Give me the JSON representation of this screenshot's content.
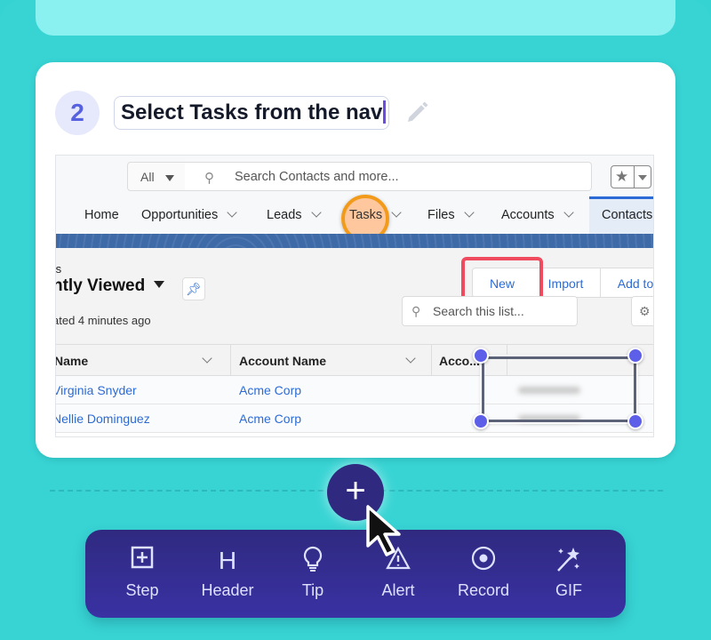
{
  "step": {
    "number": "2",
    "title": "Select Tasks from the nav"
  },
  "screenshot": {
    "global_search": {
      "scope": "All",
      "placeholder": "Search Contacts and more..."
    },
    "nav": {
      "items": [
        {
          "label": "Home",
          "has_menu": false
        },
        {
          "label": "Opportunities",
          "has_menu": true
        },
        {
          "label": "Leads",
          "has_menu": true
        },
        {
          "label": "Tasks",
          "has_menu": true,
          "highlighted": true
        },
        {
          "label": "Files",
          "has_menu": true
        },
        {
          "label": "Accounts",
          "has_menu": true
        },
        {
          "label": "Contacts",
          "has_menu": false,
          "active": true
        }
      ]
    },
    "list": {
      "object_label": "ts",
      "view_name": "ntly Viewed",
      "updated": "ated 4 minutes ago",
      "buttons": [
        "New",
        "Import",
        "Add to"
      ],
      "search_placeholder": "Search this list..."
    },
    "table": {
      "columns": [
        "Name",
        "Account Name",
        "Acco..."
      ],
      "rows": [
        {
          "name": "Virginia Snyder",
          "account": "Acme Corp"
        },
        {
          "name": "Nellie Dominguez",
          "account": "Acme Corp"
        }
      ]
    }
  },
  "toolbar": {
    "add_label": "+",
    "items": [
      {
        "label": "Step",
        "icon": "step-icon"
      },
      {
        "label": "Header",
        "icon": "header-icon"
      },
      {
        "label": "Tip",
        "icon": "lightbulb-icon"
      },
      {
        "label": "Alert",
        "icon": "alert-icon"
      },
      {
        "label": "Record",
        "icon": "record-icon"
      },
      {
        "label": "GIF",
        "icon": "magic-wand-icon"
      }
    ]
  },
  "colors": {
    "background": "#38d4d4",
    "accent": "#5d5fe8",
    "toolbar": "#2f2a80",
    "highlight_orange": "#f29b1a",
    "highlight_red": "#f04a5e",
    "link_blue": "#2c6bd6"
  }
}
